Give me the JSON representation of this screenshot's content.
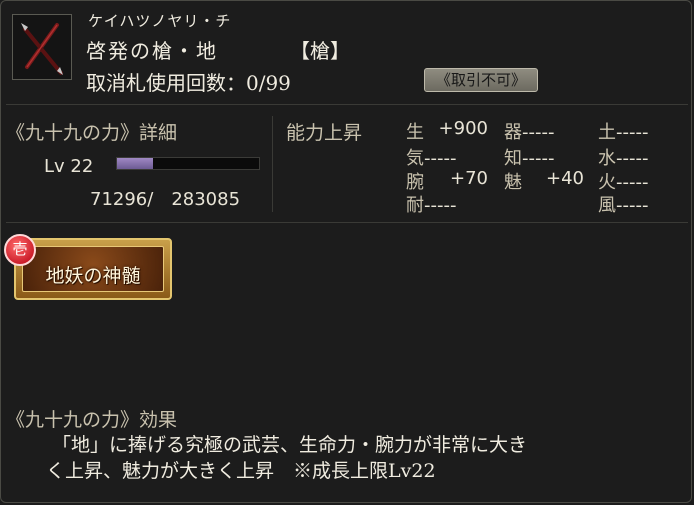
{
  "item": {
    "kana": "ケイハツノヤリ・チ",
    "name": "啓発の槍・地",
    "type": "【槍】",
    "cancel_label": "取消札使用回数：0/99",
    "trade_badge": "《取引不可》",
    "icon": "spear-icon"
  },
  "detail": {
    "title": "《九十九の力》詳細",
    "level": "Lv 22",
    "exp": "71296/　283085",
    "exp_progress": 0.25
  },
  "stats": {
    "title": "能力上昇",
    "rows": [
      [
        {
          "k": "生",
          "v": "+900"
        },
        {
          "k": "器",
          "v": "-----"
        },
        {
          "k": "土",
          "v": "-----"
        }
      ],
      [
        {
          "k": "気",
          "v": "-----"
        },
        {
          "k": "知",
          "v": "-----"
        },
        {
          "k": "水",
          "v": "-----"
        }
      ],
      [
        {
          "k": "腕",
          "v": "+70"
        },
        {
          "k": "魅",
          "v": "+40"
        },
        {
          "k": "火",
          "v": "-----"
        }
      ],
      [
        {
          "k": "耐",
          "v": "-----"
        },
        {
          "k": "",
          "v": ""
        },
        {
          "k": "風",
          "v": "-----"
        }
      ]
    ]
  },
  "card": {
    "label": "地妖の神髄",
    "badge": "壱",
    "colors": {
      "frame": "#c9a04a",
      "badge": "#d0101e"
    }
  },
  "effect": {
    "title": "《九十九の力》効果",
    "line1": "「地」に捧げる究極の武芸、生命力・腕力が非常に大き",
    "line2": "く上昇、魅力が大きく上昇　※成長上限Lv22"
  }
}
